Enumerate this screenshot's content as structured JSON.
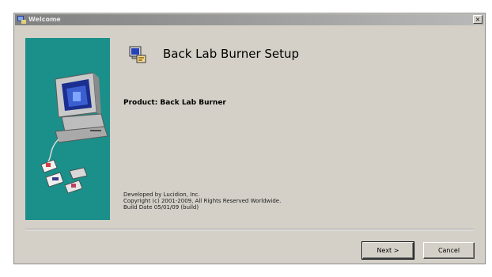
{
  "window": {
    "title": "Welcome",
    "close_glyph": "×"
  },
  "header": {
    "title": "Back Lab Burner Setup",
    "icon": "setup-installer-icon"
  },
  "product": {
    "line": "Product: Back Lab Burner"
  },
  "footer": {
    "lines": [
      "Developed by Lucidion, Inc.",
      "Copyright (c) 2001-2009, All Rights Reserved Worldwide.",
      "Build Date 05/01/09 (build)"
    ]
  },
  "buttons": {
    "next": "Next >",
    "cancel": "Cancel"
  },
  "colors": {
    "sidebar": "#1b8f8a",
    "dialog_bg": "#d4d0c8",
    "titlebar": "#808080"
  },
  "icons": {
    "sidebar_art": "computer-install-icon",
    "title_icon": "setup-app-icon"
  }
}
